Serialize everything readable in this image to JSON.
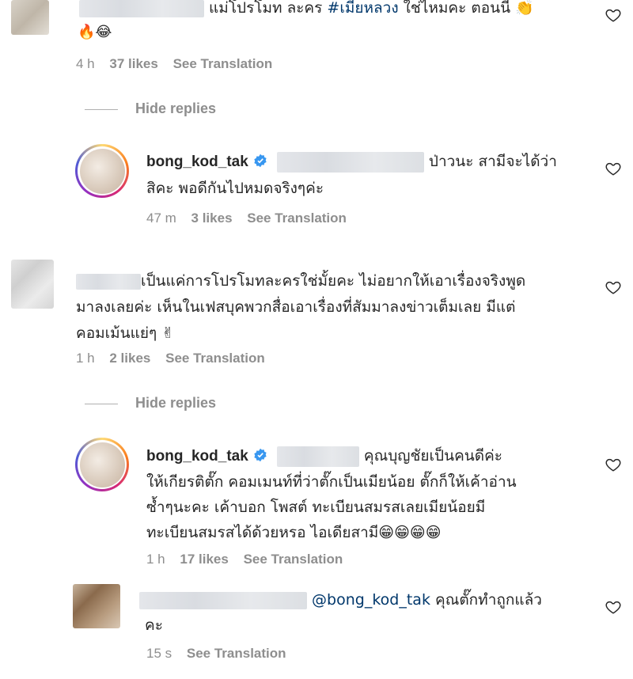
{
  "comment1": {
    "text_line1": "แม่โปรโมท ละคร",
    "hashtag": "#เมียหลวง",
    "text_line1_end": "ใช่ไหมคะ ตอนนี้ 👏",
    "text_line2": "🔥😂",
    "time": "4 h",
    "likes": "37 likes",
    "translate": "See Translation"
  },
  "hide_replies_1": "Hide replies",
  "reply1": {
    "username": "bong_kod_tak",
    "text_line1": "ป่าวนะ สามีจะได้ว่า",
    "text_line2": "สิคะ พอดีกันไปหมดจริงๆค่ะ",
    "time": "47 m",
    "likes": "3 likes",
    "translate": "See Translation"
  },
  "comment2": {
    "text_line1": "เป็นแค่การโปรโมทละครใช่มั้ยคะ ไม่อยากให้เอาเรื่องจริงพูด",
    "text_line2": "มาลงเลยค่ะ เห็นในเฟสบุคพวกสื่อเอาเรื่องที่สัมมาลงข่าวเต็มเลย มีแต่",
    "text_line3": "คอมเม้นแย่ๆ ✌",
    "time": "1 h",
    "likes": "2 likes",
    "translate": "See Translation"
  },
  "hide_replies_2": "Hide replies",
  "reply2": {
    "username": "bong_kod_tak",
    "text_line1": "คุณบุญชัยเป็นคนดีค่ะ",
    "text_line2": "ให้เกียรติตั๊ก คอมเมนท์ที่ว่าตั๊กเป็นเมียน้อย ตั๊กก็ให้เค้าอ่าน",
    "text_line3": "ซ้ำๆนะคะ เค้าบอก โพสต์ ทะเบียนสมรสเลยเมียน้อยมี",
    "text_line4": "ทะเบียนสมรสได้ด้วยหรอ ไอเดียสามี😁😁😁😁",
    "time": "1 h",
    "likes": "17 likes",
    "translate": "See Translation"
  },
  "reply3": {
    "mention": "@bong_kod_tak",
    "text_line1": "คุณตั๊กทำถูกแล้ว",
    "text_line2": "คะ",
    "time": "15 s",
    "translate": "See Translation"
  },
  "colors": {
    "meta": "#8e8e8e",
    "link": "#00376b",
    "text": "#262626",
    "verified": "#3897f0"
  },
  "icons": {
    "like": "heart-icon",
    "verified": "verified-badge-icon"
  }
}
